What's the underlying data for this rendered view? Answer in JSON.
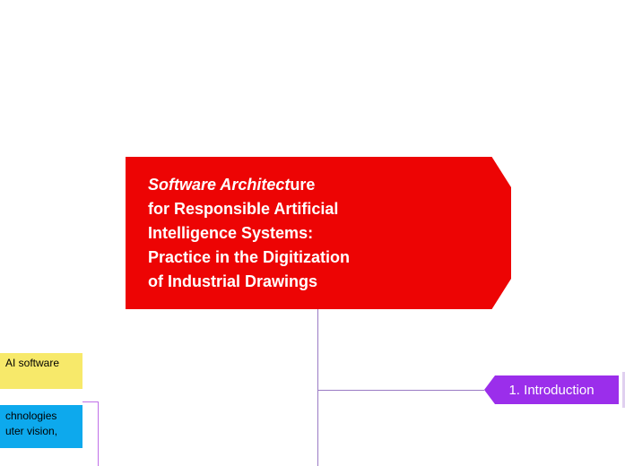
{
  "central": {
    "italic_prefix": "Software Architect",
    "text_suffix": "ure\nfor Responsible Artificial\nIntelligence Systems:\nPractice in the Digitization\nof Industrial Drawings"
  },
  "nodes": {
    "intro": "1. Introduction",
    "yellow": "AI software",
    "blue_line1": "chnologies",
    "blue_line2": "uter vision,"
  },
  "colors": {
    "central": "#ed0404",
    "intro": "#9b2eeb",
    "yellow": "#f7e96a",
    "blue": "#0da9ed"
  }
}
